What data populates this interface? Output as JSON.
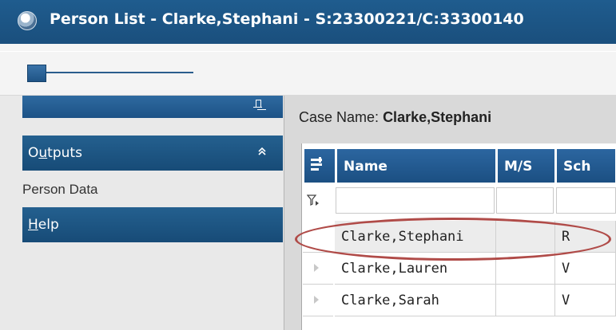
{
  "window": {
    "title": "Person List - Clarke,Stephani - S:23300221/C:33300140",
    "icon": "app-globe-icon"
  },
  "toolbar": {
    "zoom_slider": {
      "level_fraction": 0.05,
      "icon": "slider-thumb"
    }
  },
  "sidebar": {
    "pin_icon": "pin-icon",
    "outputs": {
      "label": "Outputs",
      "icon": "chevron-up-icon",
      "items": [
        "Person Data"
      ]
    },
    "help": {
      "label": "Help"
    }
  },
  "main": {
    "case_name_label": "Case Name:",
    "case_name_value": "Clarke,Stephani",
    "grid": {
      "columns": [
        "Name",
        "M/S",
        "Sch"
      ],
      "rows": [
        {
          "name": "Clarke,Stephani",
          "ms": "",
          "sch": "R",
          "selected": true
        },
        {
          "name": "Clarke,Lauren",
          "ms": "",
          "sch": "V",
          "selected": false
        },
        {
          "name": "Clarke,Sarah",
          "ms": "",
          "sch": "V",
          "selected": false
        }
      ]
    }
  },
  "colors": {
    "title_bar": "#1f5c8e",
    "header_blue": "#1b4f82",
    "highlight_oval": "#b04b48"
  }
}
